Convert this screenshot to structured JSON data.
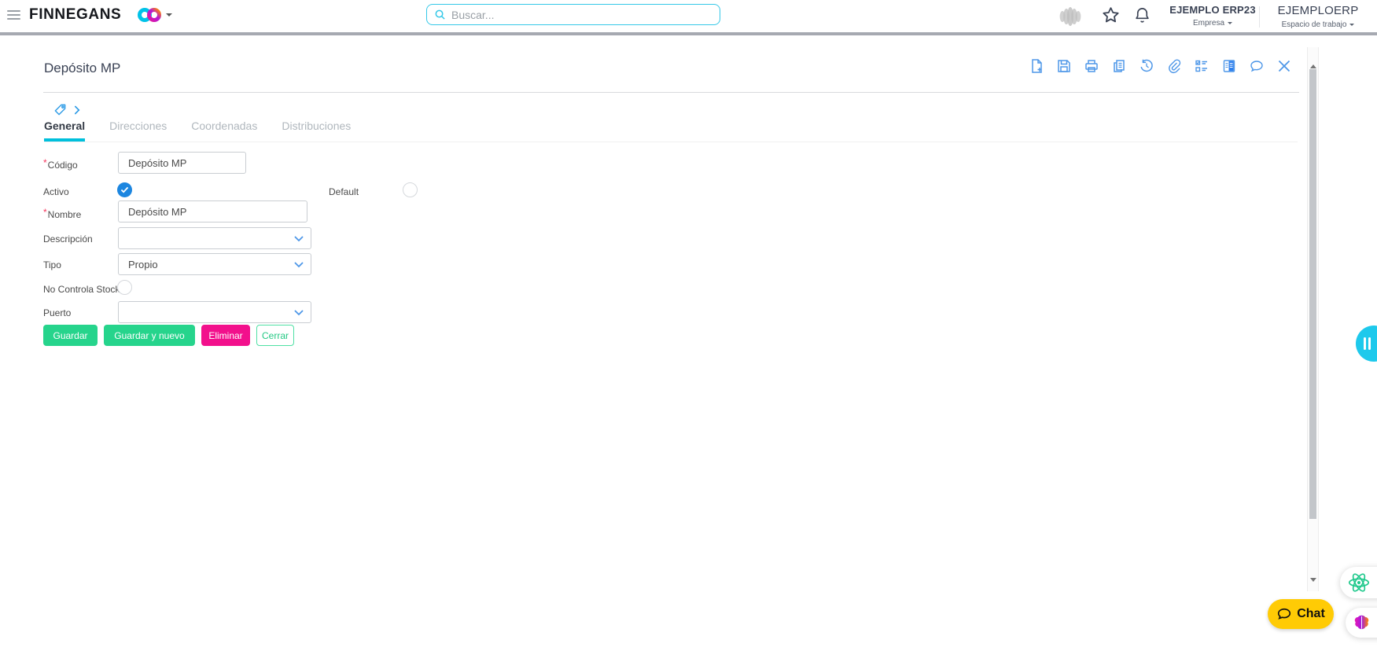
{
  "topbar": {
    "brand": "FINNEGANS",
    "search_placeholder": "Buscar...",
    "company": {
      "name": "EJEMPLO ERP23",
      "caption": "Empresa"
    },
    "workspace": {
      "name": "EJEMPLOERP",
      "caption": "Espacio de trabajo"
    }
  },
  "record": {
    "title": "Depósito MP",
    "tabs": [
      {
        "label": "General",
        "active": true
      },
      {
        "label": "Direcciones",
        "active": false
      },
      {
        "label": "Coordenadas",
        "active": false
      },
      {
        "label": "Distribuciones",
        "active": false
      }
    ],
    "toolbar_icons": [
      "new-document",
      "save",
      "print",
      "copy",
      "history",
      "attachment",
      "checklist",
      "report",
      "comments",
      "close"
    ]
  },
  "form": {
    "required_marker": "*",
    "codigo": {
      "label": "Código",
      "value": "Depósito MP",
      "required": true
    },
    "activo": {
      "label": "Activo",
      "checked": true
    },
    "default": {
      "label": "Default",
      "checked": false
    },
    "nombre": {
      "label": "Nombre",
      "value": "Depósito MP",
      "required": true
    },
    "descripcion": {
      "label": "Descripción",
      "value": ""
    },
    "tipo": {
      "label": "Tipo",
      "value": "Propio"
    },
    "no_controla_stock": {
      "label": "No Controla Stock",
      "checked": false
    },
    "puerto": {
      "label": "Puerto",
      "value": ""
    },
    "buttons": {
      "guardar": "Guardar",
      "guardar_y_nuevo": "Guardar y nuevo",
      "eliminar": "Eliminar",
      "cerrar": "Cerrar"
    }
  },
  "floating": {
    "chat": "Chat"
  },
  "colors": {
    "search_border": "#35c8e8",
    "tab_underline": "#00c0dc",
    "toolbar_icon": "#4e97e8",
    "checkbox_checked": "#1c86e0",
    "button_green": "#26d48c",
    "button_pink": "#f2108c",
    "chat_yellow": "#ffcb05",
    "handle_cyan": "#1ec9ec"
  }
}
